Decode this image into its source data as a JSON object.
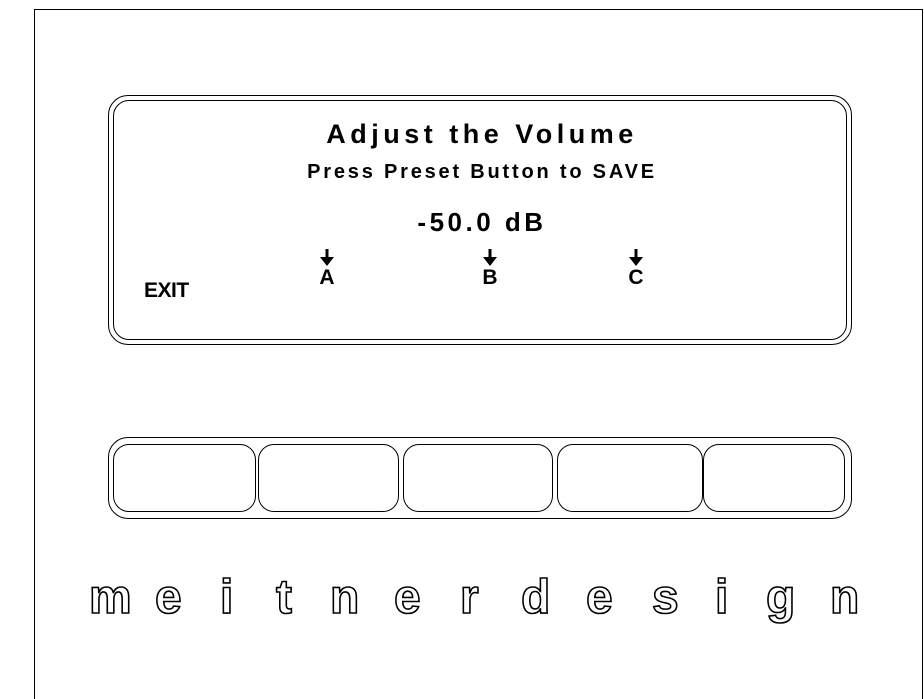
{
  "display": {
    "title": "Adjust the Volume",
    "subtitle": "Press Preset Button to SAVE",
    "volume": "-50.0 dB"
  },
  "softkeys": {
    "exit": "EXIT",
    "a": "A",
    "b": "B",
    "c": "C"
  },
  "brand": {
    "text": "meitnerdesign",
    "letters": [
      "m",
      "e",
      "i",
      "t",
      "n",
      "e",
      "r",
      "d",
      "e",
      "s",
      "i",
      "g",
      "n"
    ]
  },
  "colors": {
    "background": "#ffffff",
    "line": "#000000"
  },
  "icons": {
    "softkey_indicator": "down-arrow-icon"
  }
}
